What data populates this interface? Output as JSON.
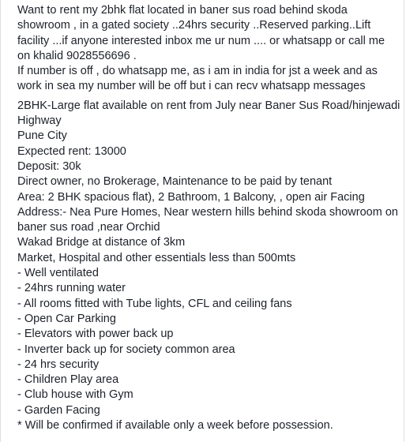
{
  "post": {
    "intro_lines": [
      "Want to rent my 2bhk flat located in baner sus road behind skoda",
      "showroom , in a gated society ..24hrs security ..Reserved parking..Lift",
      "facility ...if anyone interested inbox me ur num .... or whatsapp or call me",
      "on khalid 9028556696 .",
      "If number is off , do whatsapp me, as i am in india for jst a week and as",
      "work in sea my number will be off but i can recv whatsapp messages"
    ],
    "details_lines": [
      "2BHK-Large flat available on rent from July near Baner Sus Road/hinjewadi",
      "Highway",
      "Pune City",
      "Expected rent: 13000",
      "Deposit: 30k",
      "Direct owner, no Brokerage, Maintenance to be paid by tenant",
      "Area: 2 BHK spacious flat), 2 Bathroom, 1 Balcony, , open air Facing",
      "Address:- Nea Pure Homes, Near western hills behind skoda showroom on",
      "baner sus road ,near Orchid",
      "Wakad Bridge at distance of 3km",
      "Market, Hospital and other essentials less than 500mts",
      "- Well ventilated",
      "- 24hrs running water",
      "- All rooms fitted with Tube lights, CFL and ceiling fans",
      "- Open Car Parking",
      "- Elevators with power back up",
      "- Inverter back up for society common area",
      "- 24 hrs security",
      "- Children Play area",
      "- Club house with Gym",
      "- Garden Facing",
      "* Will be confirmed if available only a week before possession."
    ]
  }
}
